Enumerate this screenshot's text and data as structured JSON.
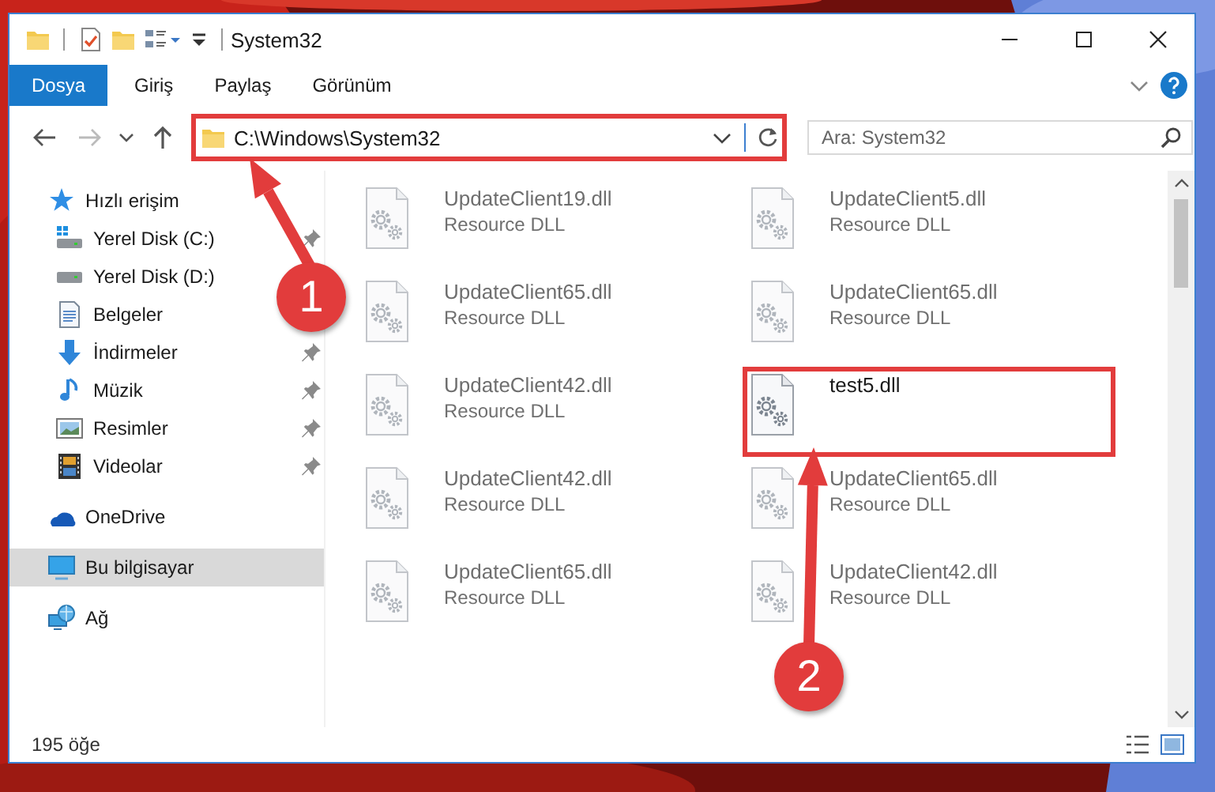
{
  "window": {
    "title": "System32"
  },
  "ribbon_tabs": [
    {
      "label": "Dosya",
      "selected": true
    },
    {
      "label": "Giriş",
      "selected": false
    },
    {
      "label": "Paylaş",
      "selected": false
    },
    {
      "label": "Görünüm",
      "selected": false
    }
  ],
  "address_bar": {
    "path": "C:\\Windows\\System32",
    "highlighted": true
  },
  "search": {
    "placeholder": "Ara: System32"
  },
  "sidebar": {
    "items": [
      {
        "label": "Hızlı erişim",
        "kind": "quick-access",
        "selected": false,
        "children": [
          {
            "label": "Yerel Disk (C:)",
            "kind": "system-drive",
            "pinned": true,
            "selected": false
          },
          {
            "label": "Yerel Disk (D:)",
            "kind": "drive",
            "selected": false
          },
          {
            "label": "Belgeler",
            "kind": "documents",
            "selected": false
          },
          {
            "label": "İndirmeler",
            "kind": "downloads",
            "pinned": true,
            "selected": false
          },
          {
            "label": "Müzik",
            "kind": "music",
            "pinned": true,
            "selected": false
          },
          {
            "label": "Resimler",
            "kind": "pictures",
            "pinned": true,
            "selected": false
          },
          {
            "label": "Videolar",
            "kind": "videos",
            "pinned": true,
            "selected": false
          }
        ]
      },
      {
        "label": "OneDrive",
        "kind": "cloud",
        "selected": false
      },
      {
        "label": "Bu bilgisayar",
        "kind": "computer",
        "selected": true
      },
      {
        "label": "Ağ",
        "kind": "network",
        "selected": false
      }
    ]
  },
  "files": [
    {
      "name": "UpdateClient19.dll",
      "type": "Resource DLL",
      "blurred": true,
      "highlighted": false
    },
    {
      "name": "UpdateClient5.dll",
      "type": "Resource DLL",
      "blurred": true,
      "highlighted": false
    },
    {
      "name": "UpdateClient65.dll",
      "type": "Resource DLL",
      "blurred": true,
      "highlighted": false
    },
    {
      "name": "UpdateClient65.dll",
      "type": "Resource DLL",
      "blurred": true,
      "highlighted": false
    },
    {
      "name": "UpdateClient42.dll",
      "type": "Resource DLL",
      "blurred": true,
      "highlighted": false
    },
    {
      "name": "test5.dll",
      "blurred": false,
      "highlighted": true
    },
    {
      "name": "UpdateClient42.dll",
      "type": "Resource DLL",
      "blurred": true,
      "highlighted": false
    },
    {
      "name": "UpdateClient65.dll",
      "type": "Resource DLL",
      "blurred": true,
      "highlighted": false
    },
    {
      "name": "UpdateClient65.dll",
      "type": "Resource DLL",
      "blurred": true,
      "highlighted": false
    },
    {
      "name": "UpdateClient42.dll",
      "type": "Resource DLL",
      "blurred": true,
      "highlighted": false
    }
  ],
  "annotations": [
    {
      "label": "1"
    },
    {
      "label": "2"
    }
  ],
  "status_bar": {
    "item_count": "195 öğe"
  }
}
